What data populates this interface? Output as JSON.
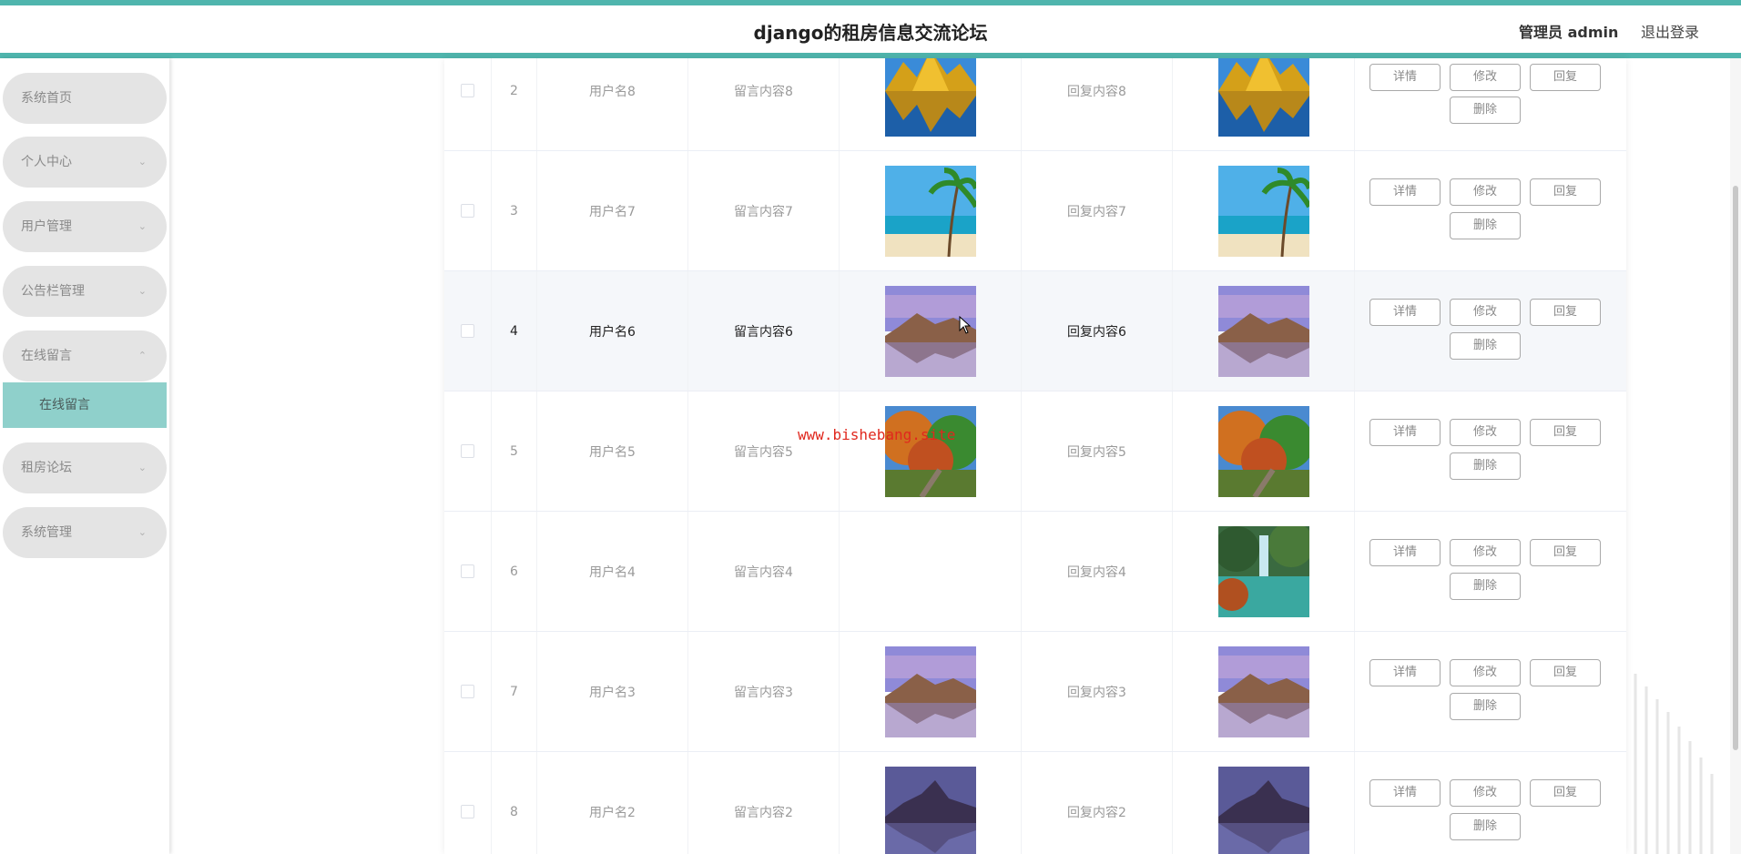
{
  "header": {
    "title": "django的租房信息交流论坛",
    "admin_label": "管理员 admin",
    "logout_label": "退出登录"
  },
  "sidebar": {
    "items": [
      {
        "label": "系统首页",
        "has_chevron": false
      },
      {
        "label": "个人中心",
        "has_chevron": true
      },
      {
        "label": "用户管理",
        "has_chevron": true
      },
      {
        "label": "公告栏管理",
        "has_chevron": true
      },
      {
        "label": "在线留言",
        "has_chevron": true,
        "expanded": true
      },
      {
        "label": "租房论坛",
        "has_chevron": true
      },
      {
        "label": "系统管理",
        "has_chevron": true
      }
    ],
    "submenu": {
      "label": "在线留言",
      "active": true
    },
    "chevron_down": "⌄",
    "chevron_up": "⌃"
  },
  "table": {
    "rows": [
      {
        "index": "2",
        "username": "用户名8",
        "message": "留言内容8",
        "message_image": "mountain-lake-reflection",
        "reply": "回复内容8",
        "reply_image": "mountain-lake-reflection"
      },
      {
        "index": "3",
        "username": "用户名7",
        "message": "留言内容7",
        "message_image": "tropical-beach-palm",
        "reply": "回复内容7",
        "reply_image": "tropical-beach-palm"
      },
      {
        "index": "4",
        "username": "用户名6",
        "message": "留言内容6",
        "message_image": "desert-lake-sunset",
        "reply": "回复内容6",
        "reply_image": "desert-lake-sunset",
        "highlighted": true
      },
      {
        "index": "5",
        "username": "用户名5",
        "message": "留言内容5",
        "message_image": "autumn-forest-steps",
        "reply": "回复内容5",
        "reply_image": "autumn-forest-steps"
      },
      {
        "index": "6",
        "username": "用户名4",
        "message": "留言内容4",
        "message_image": "",
        "reply": "回复内容4",
        "reply_image": "autumn-waterfall"
      },
      {
        "index": "7",
        "username": "用户名3",
        "message": "留言内容3",
        "message_image": "desert-lake-sunset",
        "reply": "回复内容3",
        "reply_image": "desert-lake-sunset"
      },
      {
        "index": "8",
        "username": "用户名2",
        "message": "留言内容2",
        "message_image": "purple-mountain-lake",
        "reply": "回复内容2",
        "reply_image": "purple-mountain-lake"
      }
    ],
    "actions": {
      "detail": "详情",
      "edit": "修改",
      "reply": "回复",
      "delete": "删除"
    }
  },
  "watermark": "www.bishebang.site",
  "colors": {
    "accent": "#4fb5ad",
    "submenu_active": "#8fd0cb",
    "watermark": "#e0281e"
  }
}
